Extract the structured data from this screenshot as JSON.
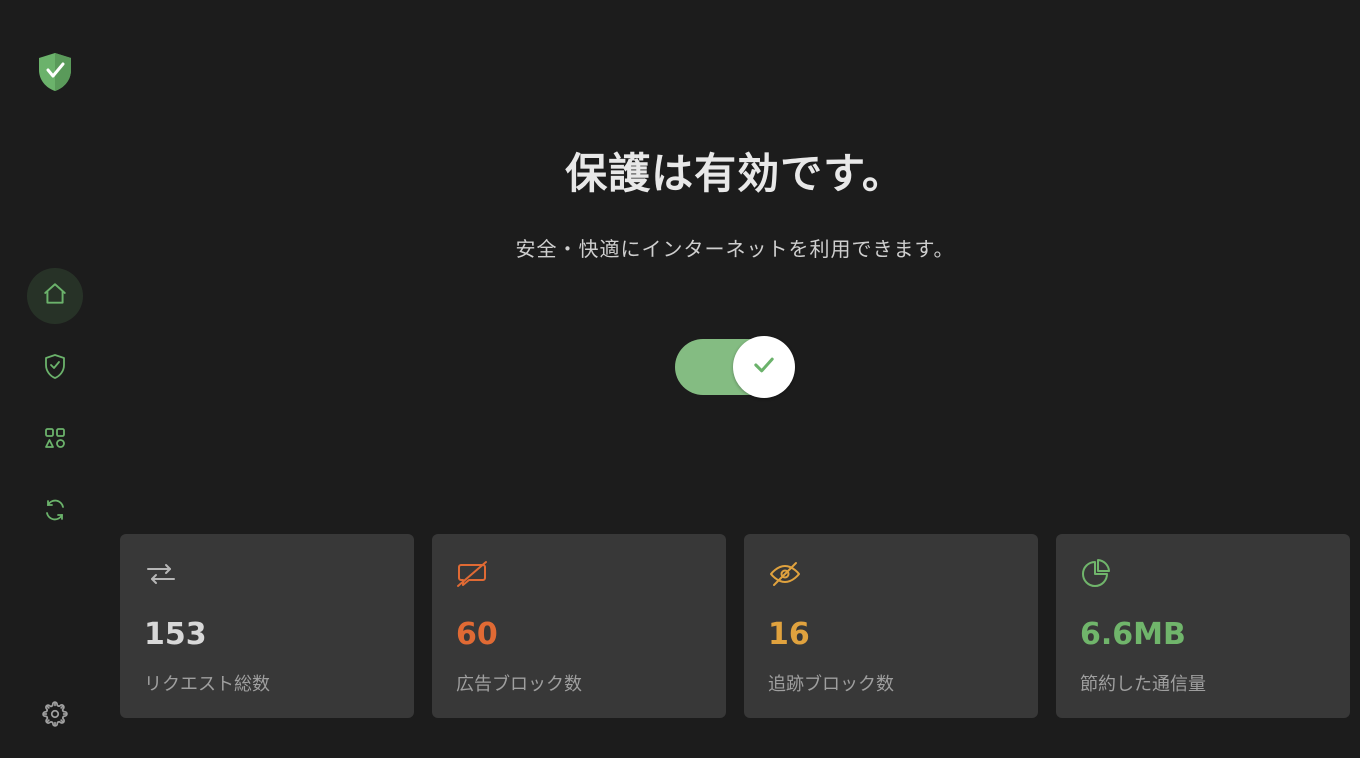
{
  "hero": {
    "title": "保護は有効です。",
    "subtitle": "安全・快適にインターネットを利用できます。"
  },
  "protection_toggle": {
    "enabled": true
  },
  "stats": {
    "requests": {
      "value": "153",
      "label": "リクエスト総数"
    },
    "ads": {
      "value": "60",
      "label": "広告ブロック数"
    },
    "trackers": {
      "value": "16",
      "label": "追跡ブロック数"
    },
    "data": {
      "value": "6.6MB",
      "label": "節約した通信量"
    }
  },
  "nav": {
    "home": "home",
    "protection": "protection",
    "apps": "apps",
    "update": "update",
    "settings": "settings"
  },
  "colors": {
    "green": "#6bb26b",
    "orange": "#e06a34",
    "yellow": "#e0a23e"
  }
}
